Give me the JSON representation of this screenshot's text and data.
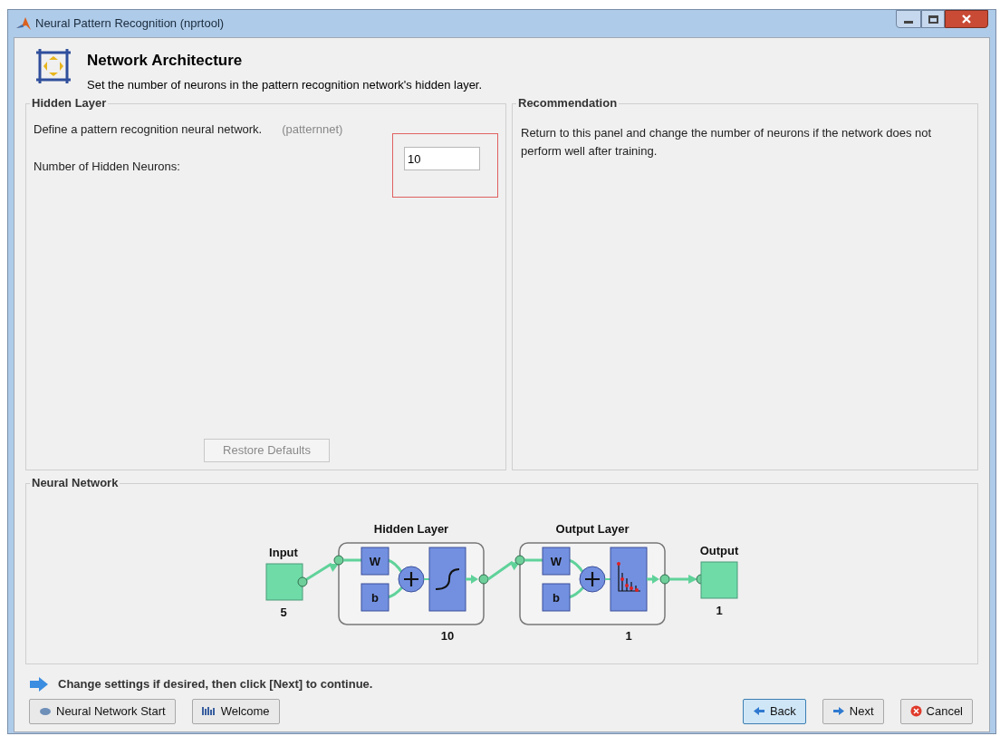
{
  "window": {
    "title": "Neural Pattern Recognition (nprtool)"
  },
  "header": {
    "title": "Network Architecture",
    "subtitle": "Set the number of neurons in the pattern recognition network's hidden layer."
  },
  "hidden_layer": {
    "title": "Hidden Layer",
    "description": "Define a pattern recognition neural network.",
    "function_name": "(patternnet)",
    "neurons_label": "Number of Hidden Neurons:",
    "neurons_value": "10",
    "restore_button": {
      "label": "Restore Defaults",
      "disabled": true
    }
  },
  "recommendation": {
    "title": "Recommendation",
    "text": "Return to this panel and change the number of neurons if the network does not perform well after training."
  },
  "neural_network": {
    "title": "Neural Network",
    "input": {
      "label": "Input",
      "size": "5"
    },
    "layers": [
      {
        "title": "Hidden Layer",
        "weight": "W",
        "bias": "b",
        "size": "10",
        "kind": "sigmoid"
      },
      {
        "title": "Output Layer",
        "weight": "W",
        "bias": "b",
        "size": "1",
        "kind": "softmax"
      }
    ],
    "output": {
      "label": "Output",
      "size": "1"
    }
  },
  "hint": "Change settings  if desired, then click [Next] to continue.",
  "left_buttons": [
    {
      "label": "Neural Network Start",
      "kind": "start"
    },
    {
      "label": "Welcome",
      "kind": "welcome"
    }
  ],
  "right_buttons": [
    {
      "label": "Back",
      "kind": "back",
      "focused": true
    },
    {
      "label": "Next",
      "kind": "next",
      "focused": false
    },
    {
      "label": "Cancel",
      "kind": "cancel",
      "focused": false
    }
  ]
}
